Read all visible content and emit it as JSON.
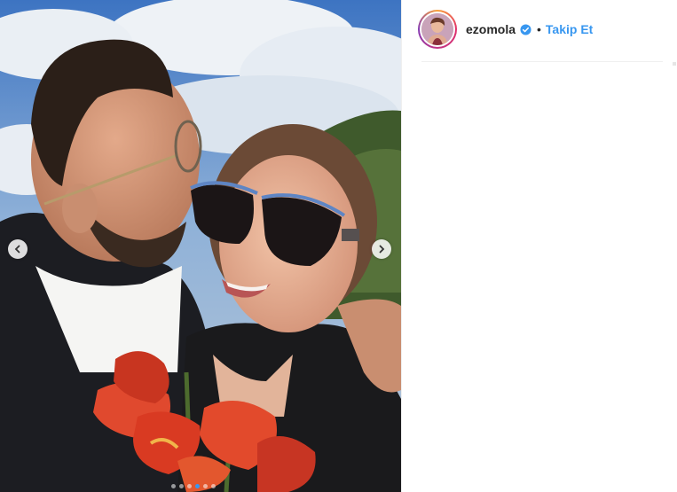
{
  "post": {
    "author": {
      "username": "ezomola",
      "verified": true,
      "separator": "•",
      "follow_label": "Takip Et"
    },
    "media": {
      "nav_prev_icon": "chevron-left-icon",
      "nav_next_icon": "chevron-right-icon",
      "carousel_count": 6,
      "carousel_active_index": 3
    }
  },
  "colors": {
    "link_blue": "#3897f0",
    "text_dark": "#262626",
    "divider": "#efefef"
  }
}
